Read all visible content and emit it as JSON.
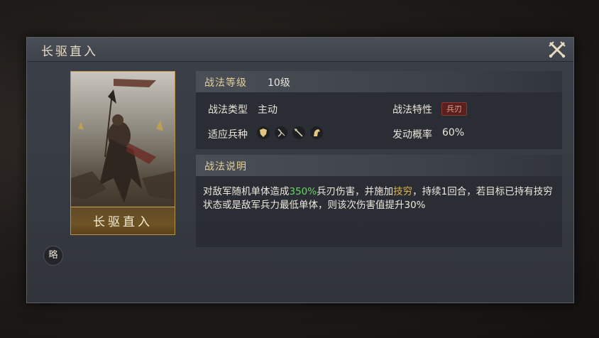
{
  "dialog": {
    "title": "长驱直入"
  },
  "card": {
    "name": "长驱直入"
  },
  "strategy_badge": "略",
  "level": {
    "label": "战法等级",
    "value": "10级"
  },
  "type": {
    "label": "战法类型",
    "value": "主动"
  },
  "trait": {
    "label": "战法特性",
    "badge": "兵刃"
  },
  "troops": {
    "label": "适应兵种",
    "icons": [
      "shield-troop-icon",
      "bow-troop-icon",
      "spear-troop-icon",
      "cavalry-troop-icon"
    ]
  },
  "chance": {
    "label": "发动概率",
    "value": "60%"
  },
  "description": {
    "label": "战法说明",
    "seg1": "对敌军随机单体造成",
    "seg2": "350%",
    "seg3": "兵刃伤害，并施加",
    "seg4": "技穷",
    "seg5": "，持续1回合，若目标已持有技穷状态或是敌军兵力最低单体，则该次伤害值提升30%"
  },
  "colors": {
    "accent_gold": "#e2cf9a",
    "highlight_green": "#6fd36a",
    "highlight_gold": "#e0b24a",
    "trait_red": "#5a2020"
  }
}
